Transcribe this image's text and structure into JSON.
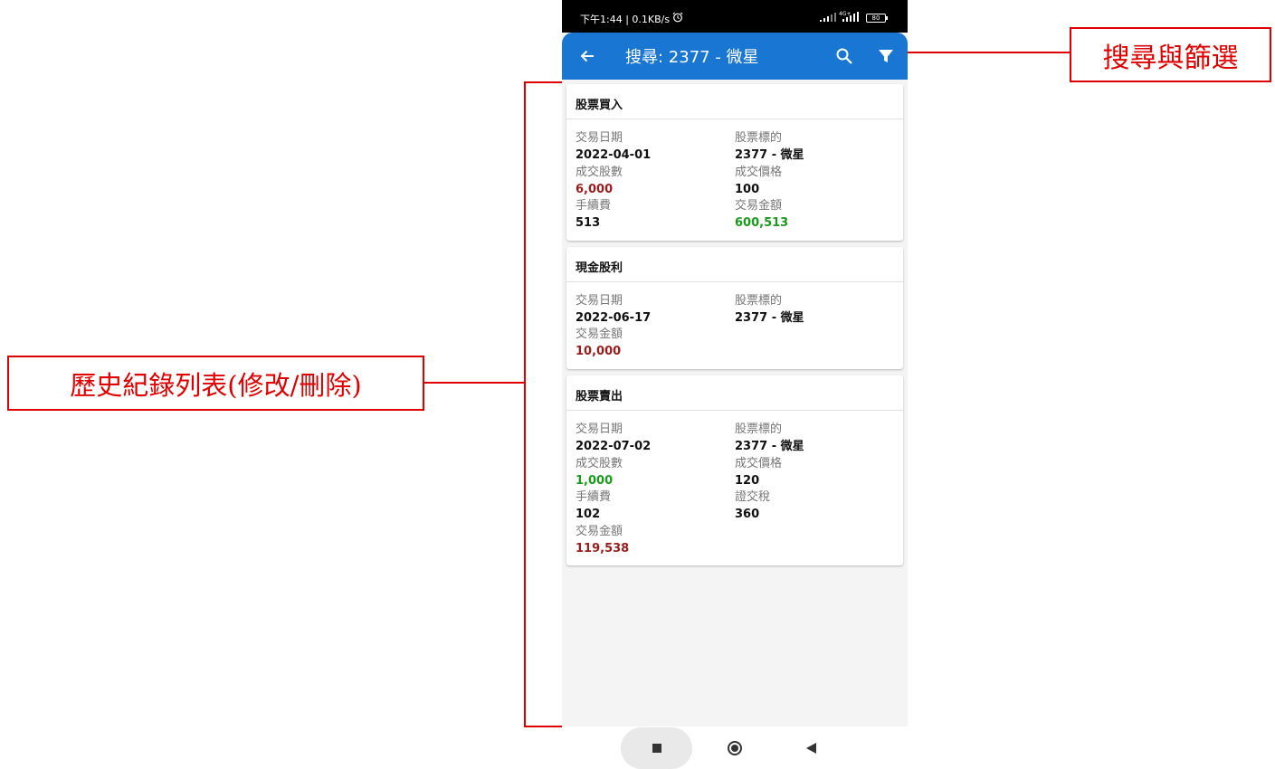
{
  "status_bar": {
    "time": "下午1:44 | 0.1KB/s",
    "battery": "80",
    "network": "4G+"
  },
  "app_bar": {
    "title": "搜尋: 2377 - 微星",
    "icons": [
      "arrow-back-icon",
      "search-icon",
      "filter-icon"
    ]
  },
  "cards": [
    {
      "title": "股票買入",
      "fields": [
        {
          "label": "交易日期",
          "value": "2022-04-01"
        },
        {
          "label": "股票標的",
          "value": "2377 - 微星"
        },
        {
          "label": "成交股數",
          "value": "6,000"
        },
        {
          "label": "成交價格",
          "value": "100"
        },
        {
          "label": "手續費",
          "value": "513"
        },
        {
          "label": "交易金額",
          "value": "600,513"
        }
      ]
    },
    {
      "title": "現金股利",
      "fields": [
        {
          "label": "交易日期",
          "value": "2022-06-17"
        },
        {
          "label": "股票標的",
          "value": "2377 - 微星"
        },
        {
          "label": "交易金額",
          "value": "10,000"
        }
      ]
    },
    {
      "title": "股票賣出",
      "fields": [
        {
          "label": "交易日期",
          "value": "2022-07-02"
        },
        {
          "label": "股票標的",
          "value": "2377 - 微星"
        },
        {
          "label": "成交股數",
          "value": "1,000"
        },
        {
          "label": "成交價格",
          "value": "120"
        },
        {
          "label": "手續費",
          "value": "102"
        },
        {
          "label": "證交稅",
          "value": "360"
        },
        {
          "label": "交易金額",
          "value": "119,538"
        }
      ]
    }
  ],
  "annotations": {
    "search_filter": "搜尋與篩選",
    "history_list": "歷史紀錄列表(修改/刪除)"
  },
  "colors": {
    "app_bar": "#1976d2",
    "value_red": "#9b1c1c",
    "value_green": "#1a9b1a",
    "annotation": "#e00000"
  }
}
